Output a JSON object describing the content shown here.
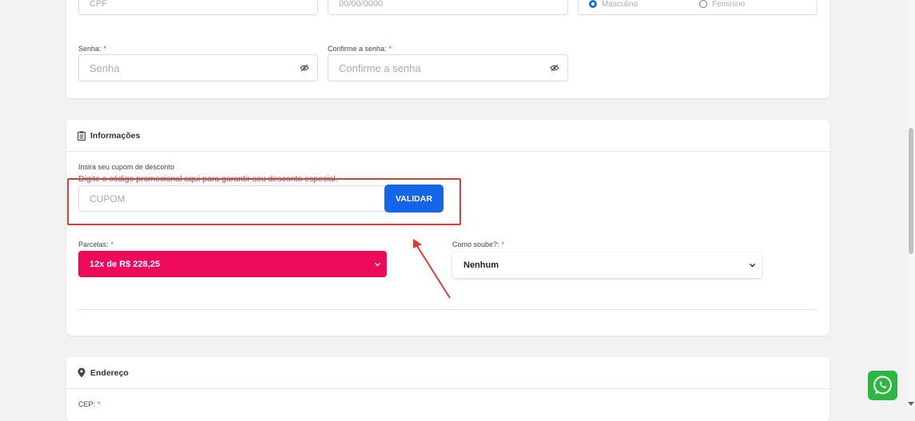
{
  "personal": {
    "cpf_placeholder": "CPF",
    "birthdate_placeholder": "00/00/0000",
    "gender_options": [
      "Masculino",
      "Feminino"
    ],
    "gender_selected": "Masculino"
  },
  "password": {
    "senha_label": "Senha:",
    "senha_placeholder": "Senha",
    "confirm_label": "Confirme a senha:",
    "confirm_placeholder": "Confirme a senha",
    "required_mark": "*"
  },
  "informacoes": {
    "title": "Informações",
    "coupon_label": "Insira seu cupom de desconto",
    "coupon_hint": "Digite o código promocional aqui para garantir seu desconto especial.",
    "coupon_placeholder": "CUPOM",
    "validate_button": "VALIDAR",
    "parcelas_label": "Parcelas:",
    "parcelas_value": "12x de R$ 228,25",
    "como_soube_label": "Como soube?:",
    "como_soube_value": "Nenhum"
  },
  "endereco": {
    "title": "Endereço",
    "cep_label": "CEP:"
  },
  "colors": {
    "background": "#f2f2f2",
    "primary_button": "#1565e8",
    "parcelas_select": "#ee0a5b",
    "annotation_red": "#e53935",
    "required_red": "#e53935",
    "whatsapp_green": "#2bb741",
    "radio_blue": "#1976d2"
  },
  "icons": {
    "section_informacoes": "clipboard-icon",
    "section_endereco": "map-marker-icon",
    "password_toggle": "eye-slash-icon",
    "floating_button": "whatsapp-icon",
    "select_arrow": "chevron-down-icon"
  }
}
